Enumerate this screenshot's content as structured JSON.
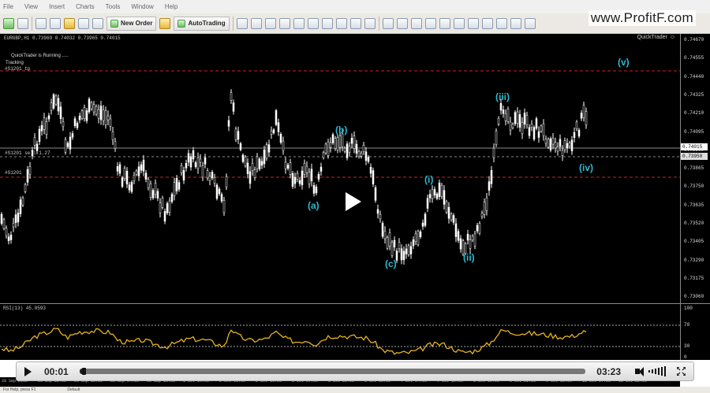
{
  "menu": [
    "File",
    "View",
    "Insert",
    "Charts",
    "Tools",
    "Window",
    "Help"
  ],
  "toolbar": {
    "new_order": "New Order",
    "autotrading": "AutoTrading"
  },
  "watermark": "www.ProfitF.com",
  "chart": {
    "symbol_line": "EURGBP,H1  0.73969 0.74032 0.73965 0.74015",
    "quicktrader_label": "QuickTrader",
    "quicktrader_status": "QuickTrader is Running .....",
    "tracking": "Tracking",
    "hline_top_label": "#S1201 tp",
    "hline_mid_label": "#S1201 sell 1.27",
    "hline_bot_label": "#S1201",
    "current_price_tag": "0.74015",
    "stop_price_tag": "0.73950",
    "price_ticks": [
      "0.74670",
      "0.74555",
      "0.74440",
      "0.74325",
      "0.74210",
      "0.74095",
      "0.73980",
      "0.73865",
      "0.73750",
      "0.73635",
      "0.73520",
      "0.73405",
      "0.73290",
      "0.73175",
      "0.73060"
    ],
    "waves": [
      {
        "label": "(a)"
      },
      {
        "label": "(b)"
      },
      {
        "label": "(c)"
      },
      {
        "label": "(i)"
      },
      {
        "label": "(ii)"
      },
      {
        "label": "(iii)"
      },
      {
        "label": "(iv)"
      },
      {
        "label": "(v)"
      }
    ],
    "colors": {
      "candle": "#ffffff",
      "hline": "#cc1f1f",
      "wave_label": "#2db8cf",
      "rsi_line": "#e6b31e",
      "background": "#000000"
    }
  },
  "rsi": {
    "title": "RSI(13) 45.0593",
    "ticks": [
      "100",
      "70",
      "30",
      "0"
    ]
  },
  "time_axis": [
    "28 Sep 2015",
    "28 Sep 22:00",
    "29 Sep 13:00",
    "30 Sep 04:00",
    "30 Sep 19:00",
    "1 Oct 10:00",
    "2 Oct 01:00",
    "2 Oct 16:00",
    "5 Oct 07:00",
    "5 Oct 22:00",
    "6 Oct 13:00",
    "7 Oct 04:00",
    "7 Oct 19:00",
    "8 Oct 10:00",
    "9 Oct 01:00",
    "9 Oct 16:00",
    "12 Oct 07:00",
    "12 Oct 22:00"
  ],
  "player": {
    "current_time": "00:01",
    "duration": "03:23",
    "progress": 0.005
  },
  "status": [
    "For Help, press F1",
    "Default"
  ]
}
